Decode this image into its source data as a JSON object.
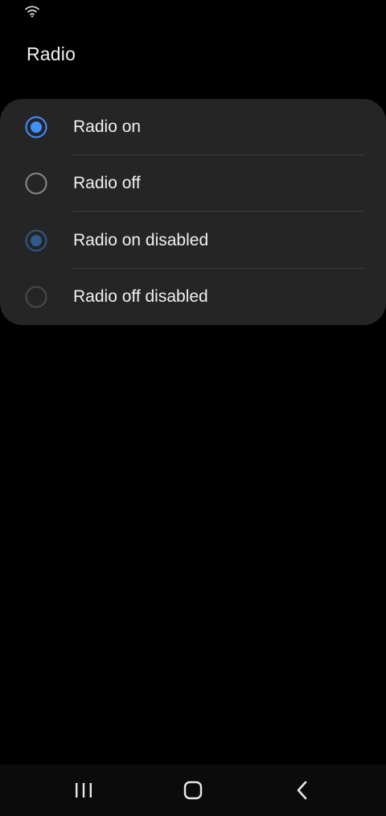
{
  "status_bar": {
    "icons": [
      "wifi-icon"
    ]
  },
  "page": {
    "title": "Radio"
  },
  "radio_list": {
    "items": [
      {
        "label": "Radio on",
        "checked": true,
        "disabled": false
      },
      {
        "label": "Radio off",
        "checked": false,
        "disabled": false
      },
      {
        "label": "Radio on disabled",
        "checked": true,
        "disabled": true
      },
      {
        "label": "Radio off disabled",
        "checked": false,
        "disabled": true
      }
    ]
  },
  "nav_bar": {
    "icons": [
      "recents-icon",
      "home-icon",
      "back-icon"
    ]
  },
  "colors": {
    "background": "#000000",
    "card": "#252525",
    "accent": "#3e91ff",
    "accent_disabled": "#2f5a8c",
    "radio_off_border": "#8a8a8a",
    "radio_off_disabled_border": "#4a4a4a",
    "text": "#f0f0f0",
    "divider": "#3d3d3d"
  }
}
